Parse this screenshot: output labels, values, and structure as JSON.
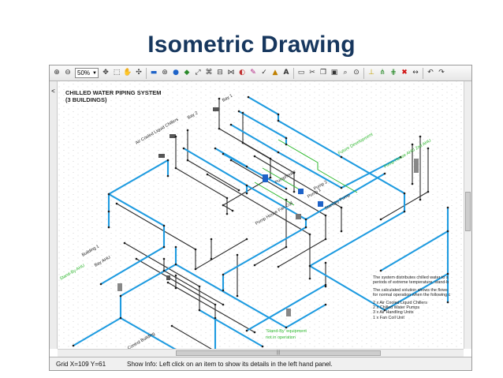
{
  "slide": {
    "title": "Isometric Drawing"
  },
  "toolbar": {
    "zoom_value": "50%",
    "icons": [
      "zoom-in-icon",
      "zoom-out-icon",
      "pan-icon",
      "select-icon",
      "hand-icon",
      "move-icon",
      "pipe-icon",
      "pump-icon",
      "node-icon",
      "link-icon",
      "chiller-icon",
      "fan-coil-icon",
      "tank-icon",
      "valve-icon",
      "flow-icon",
      "edit-icon",
      "text-icon",
      "box-icon",
      "cut-icon",
      "copy-icon",
      "paste-icon",
      "find-icon",
      "zoom-fit-icon",
      "tee-icon",
      "merge-icon",
      "grid-icon",
      "delete-icon",
      "undo-icon",
      "redo-icon"
    ]
  },
  "drawing": {
    "title_line1": "CHILLED WATER PIPING SYSTEM",
    "title_line2": "(3 BUILDINGS)",
    "labels": {
      "bay1": "Bay 1",
      "bay2": "Bay 2",
      "chillers": "Air Cooled Liquid Chillers",
      "future": "Future Development",
      "pumphouse": "Pumphouse",
      "pumphouse_fan_coil": "Pump House Fan Coil",
      "pump1": "Pump 1",
      "pump2": "Pump 2",
      "standby_pump": "Standby Pump",
      "building1": "Building 1",
      "bay_ahu": "Bay AHU",
      "standby_ahu": "Stand-By AHU",
      "control_building": "Control Building",
      "standby_note_line1": "'Stand-By' equipment",
      "standby_note_line2": "not in operation",
      "pumphouse_ahu": "Pump House AHU 2nd AHU"
    },
    "description_lines": [
      "The system distributes chilled water to s",
      "periods of extreme temperature, stand-b",
      "The calculated solution shows the flows",
      "for normal operation when the following c",
      "2 x Air Cooled Liquid Chillers",
      "2 x Chilled Water Pumps",
      "3 x Air Handling Units",
      "1 x Fan Coil Unit"
    ]
  },
  "statusbar": {
    "grid": "Grid  X=109  Y=61",
    "info": "Show Info: Left click on an item to show its details in the left hand panel."
  },
  "colors": {
    "title": "#17375e",
    "pipe_blue": "#1e9be0",
    "pipe_dark": "#2b2b2b",
    "pipe_green": "#2eb82e",
    "grid_dot": "#c9c9c9"
  }
}
